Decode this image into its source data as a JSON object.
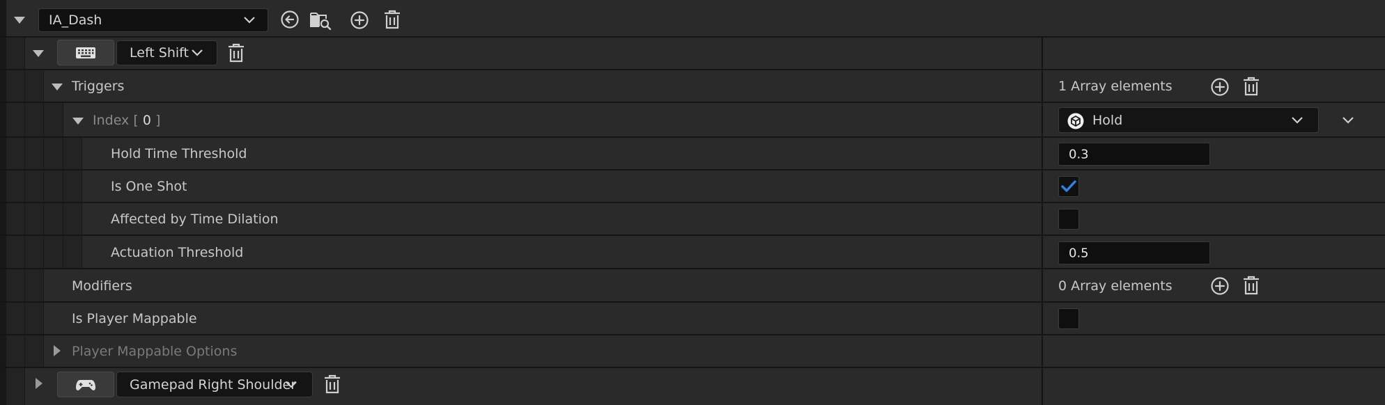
{
  "asset": {
    "name": "IA_Dash",
    "toolbar_icons": [
      "browse-back-icon",
      "find-in-content-browser-icon",
      "add-icon",
      "delete-icon"
    ]
  },
  "mappings": [
    {
      "key_icon": "keyboard-icon",
      "key_label": "Left Shift",
      "expanded": true
    },
    {
      "key_icon": "gamepad-icon",
      "key_label": "Gamepad Right Shoulder",
      "expanded": false
    }
  ],
  "triggers": {
    "label": "Triggers",
    "count_text": "1 Array elements",
    "index": {
      "label": "Index",
      "bracket_open": "[",
      "value": "0",
      "bracket_close": "]",
      "type_label": "Hold",
      "type_icon": "hold-trigger-icon"
    },
    "properties": {
      "hold_time_threshold": {
        "label": "Hold Time Threshold",
        "value": "0.3"
      },
      "is_one_shot": {
        "label": "Is One Shot",
        "checked": true
      },
      "affected_by_time_dilation": {
        "label": "Affected by Time Dilation",
        "checked": false
      },
      "actuation_threshold": {
        "label": "Actuation Threshold",
        "value": "0.5"
      }
    }
  },
  "modifiers": {
    "label": "Modifiers",
    "count_text": "0 Array elements"
  },
  "is_player_mappable": {
    "label": "Is Player Mappable",
    "checked": false
  },
  "player_mappable_options": {
    "label": "Player Mappable Options"
  },
  "colors": {
    "panel": "#2a2a2a",
    "field_bg": "#0f0f0f",
    "check_blue": "#2d83e8",
    "text": "#c8c8c8"
  }
}
